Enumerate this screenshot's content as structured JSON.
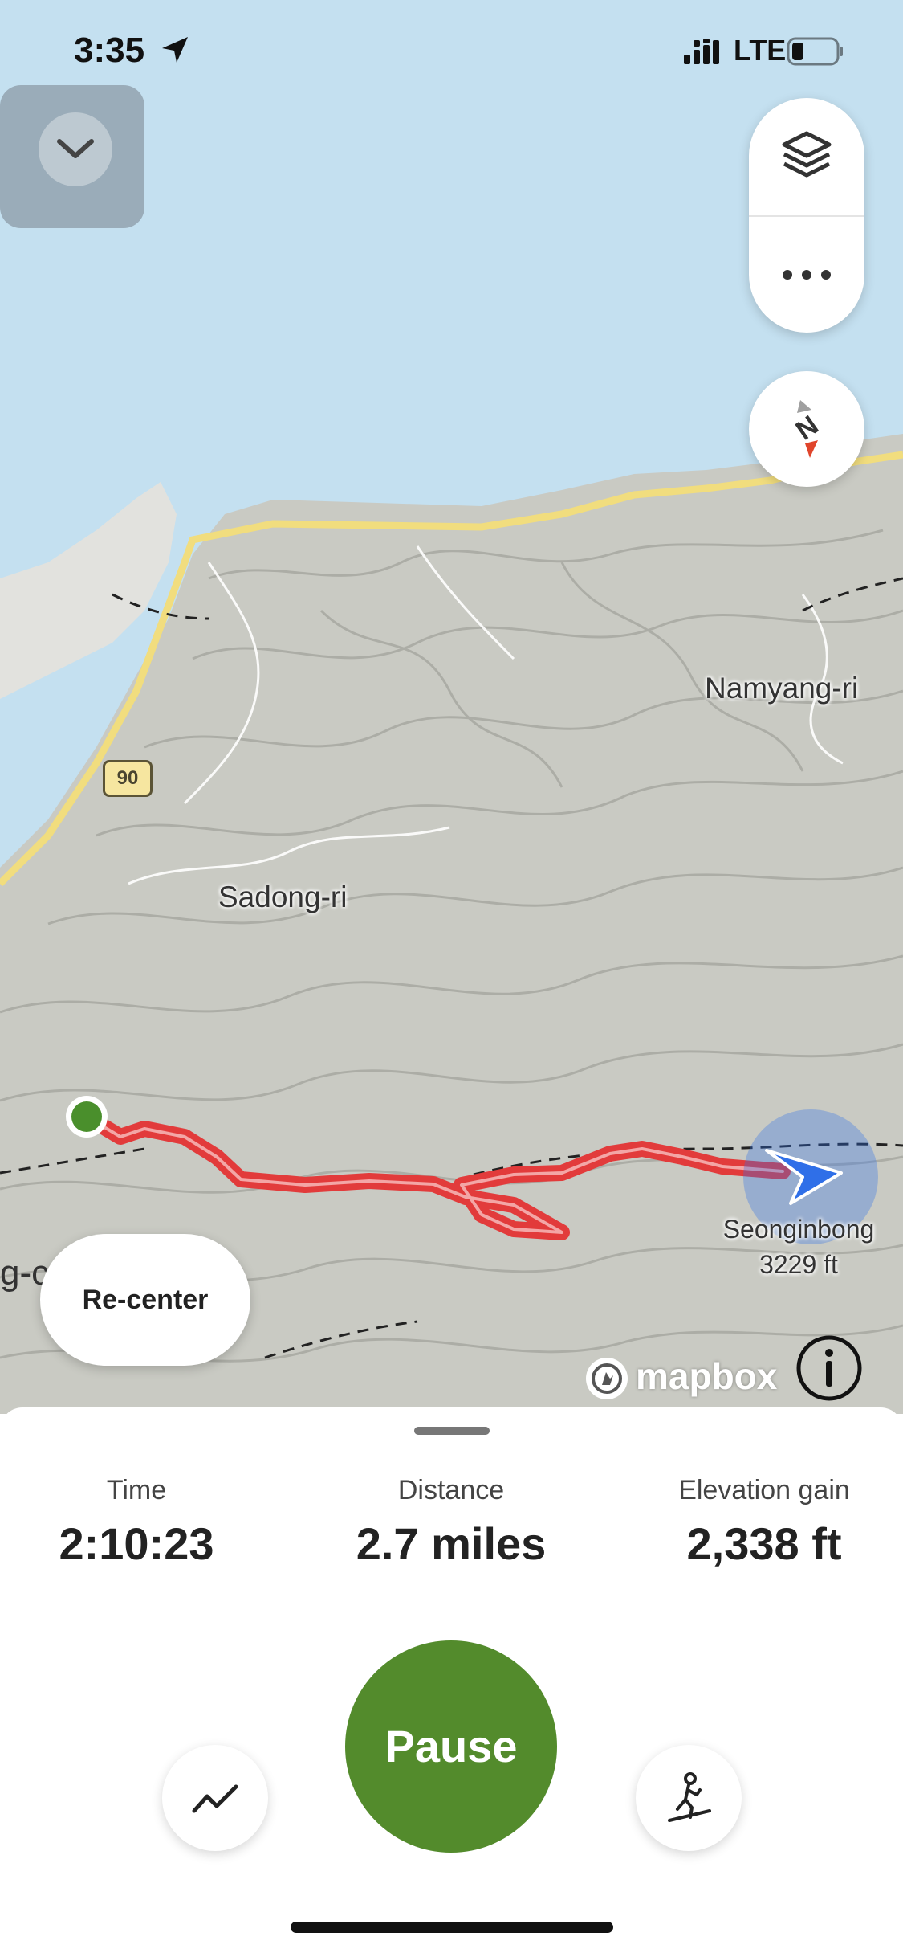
{
  "status_bar": {
    "time": "3:35",
    "network": "LTE",
    "location_icon": "location-arrow-icon",
    "signal_icon": "signal-icon",
    "battery_icon": "battery-icon"
  },
  "map": {
    "labels": {
      "village_north": "Namyang-ri",
      "village_center": "Sadong-ri",
      "road_number": "90",
      "partial_label": "g-c"
    },
    "peak": {
      "name": "Seonginbong",
      "elevation": "3229 ft"
    },
    "controls": {
      "collapse_icon": "chevron-down-icon",
      "layers_icon": "layers-icon",
      "more_icon": "more-icon",
      "compass_icon": "compass-icon",
      "compass_letter": "N"
    },
    "recenter_label": "Re-center",
    "attribution": "mapbox",
    "info_icon": "info-icon",
    "colors": {
      "water": "#c4e0f0",
      "land": "#c9cac3",
      "road": "#f1dd7e",
      "track": "#e23b3b",
      "start_marker": "#4a8f2c",
      "position_marker": "#2f6fe8"
    }
  },
  "stats": {
    "time": {
      "label": "Time",
      "value": "2:10:23"
    },
    "distance": {
      "label": "Distance",
      "value": "2.7 miles"
    },
    "elevation": {
      "label": "Elevation gain",
      "value": "2,338 ft"
    }
  },
  "actions": {
    "pause_label": "Pause",
    "stats_icon": "trend-line-icon",
    "activity_icon": "hiker-icon",
    "accent": "#538b2c"
  }
}
